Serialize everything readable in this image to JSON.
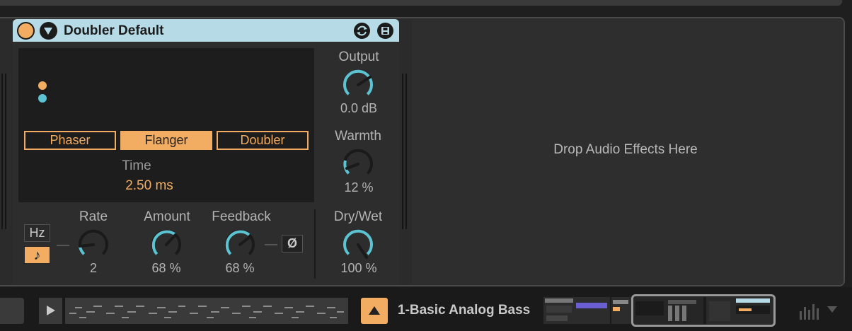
{
  "device": {
    "title": "Doubler Default",
    "modes": [
      "Phaser",
      "Flanger",
      "Doubler"
    ],
    "active_mode": "Flanger",
    "time": {
      "label": "Time",
      "value": "2.50 ms"
    },
    "output": {
      "label": "Output",
      "value": "0.0 dB"
    },
    "warmth": {
      "label": "Warmth",
      "value": "12 %"
    },
    "rate": {
      "label": "Rate",
      "value": "2",
      "hz_label": "Hz",
      "note_label": "♪"
    },
    "amount": {
      "label": "Amount",
      "value": "68 %"
    },
    "feedback": {
      "label": "Feedback",
      "value": "68 %",
      "phase_label": "Ø"
    },
    "drywet": {
      "label": "Dry/Wet",
      "value": "100 %"
    }
  },
  "drop_zone": {
    "label": "Drop Audio Effects Here"
  },
  "bottom": {
    "track_name": "1-Basic Analog Bass"
  },
  "colors": {
    "accent": "#f2ad62",
    "header": "#b7dbe6",
    "knob_arc": "#5cc3d3"
  }
}
